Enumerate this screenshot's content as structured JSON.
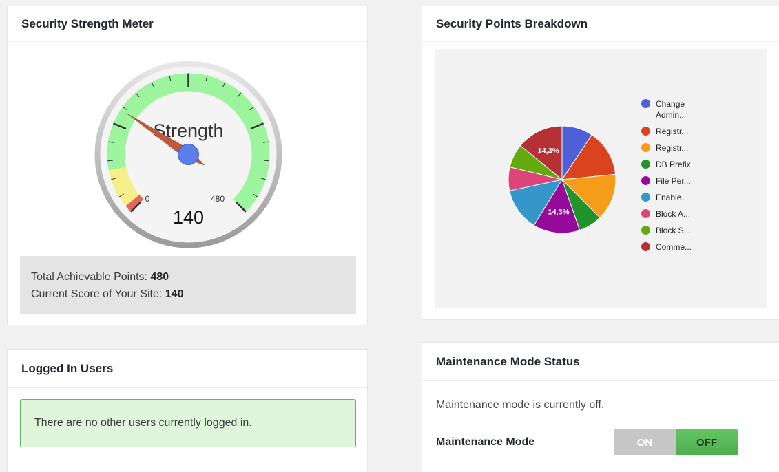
{
  "meter_panel": {
    "title": "Security Strength Meter",
    "gauge": {
      "label": "Strength",
      "value": 140,
      "value_text": "140",
      "min": 0,
      "min_text": "0",
      "max": 480,
      "max_text": "480",
      "colors": {
        "green": "#9cf59c",
        "yellow": "#f5f08a",
        "red": "#e06a5a",
        "needle": "#c0583a",
        "hub": "#5b7fe8"
      }
    },
    "total_label": "Total Achievable Points: ",
    "total_value": "480",
    "current_label": "Current Score of Your Site: ",
    "current_value": "140"
  },
  "breakdown_panel": {
    "title": "Security Points Breakdown",
    "chart_data": {
      "type": "pie",
      "labels": [
        "Change Admin...",
        "Registr...",
        "Registr...",
        "DB Prefix",
        "File Per...",
        "Enable...",
        "Block A...",
        "Block S...",
        "Comme..."
      ],
      "values": [
        7.1,
        10.7,
        10.7,
        5.4,
        10.7,
        9.8,
        5.4,
        5.4,
        10.7
      ],
      "colors": [
        "#4f5fd8",
        "#d9441f",
        "#f59c1a",
        "#22922b",
        "#950a9b",
        "#3496c9",
        "#dd4479",
        "#63a910",
        "#b53135"
      ],
      "data_labels": [
        "14,3%",
        "14,3%"
      ],
      "legend": "right"
    }
  },
  "users_panel": {
    "title": "Logged In Users",
    "message": "There are no other users currently logged in."
  },
  "maint_panel": {
    "title": "Maintenance Mode Status",
    "status_text": "Maintenance mode is currently off.",
    "toggle_label": "Maintenance Mode",
    "on_label": "ON",
    "off_label": "OFF",
    "selected": "OFF"
  }
}
